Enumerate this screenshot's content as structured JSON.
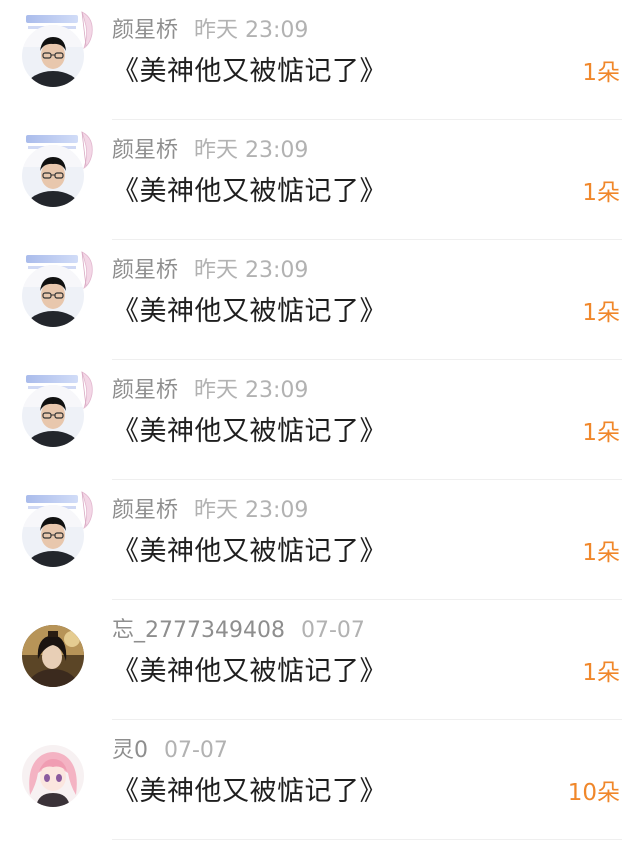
{
  "accent_color": "#f0872a",
  "records": [
    {
      "user": "颜星桥",
      "time": "昨天 23:09",
      "gift": "《美神他又被惦记了》",
      "count": "1朵",
      "avatar": "boy-glasses-avatar"
    },
    {
      "user": "颜星桥",
      "time": "昨天 23:09",
      "gift": "《美神他又被惦记了》",
      "count": "1朵",
      "avatar": "boy-glasses-avatar"
    },
    {
      "user": "颜星桥",
      "time": "昨天 23:09",
      "gift": "《美神他又被惦记了》",
      "count": "1朵",
      "avatar": "boy-glasses-avatar"
    },
    {
      "user": "颜星桥",
      "time": "昨天 23:09",
      "gift": "《美神他又被惦记了》",
      "count": "1朵",
      "avatar": "boy-glasses-avatar"
    },
    {
      "user": "颜星桥",
      "time": "昨天 23:09",
      "gift": "《美神他又被惦记了》",
      "count": "1朵",
      "avatar": "boy-glasses-avatar"
    },
    {
      "user": "忘_2777349408",
      "time": "07-07",
      "gift": "《美神他又被惦记了》",
      "count": "1朵",
      "avatar": "ancient-costume-avatar"
    },
    {
      "user": "灵0",
      "time": "07-07",
      "gift": "《美神他又被惦记了》",
      "count": "10朵",
      "avatar": "pink-hair-girl-avatar"
    }
  ]
}
